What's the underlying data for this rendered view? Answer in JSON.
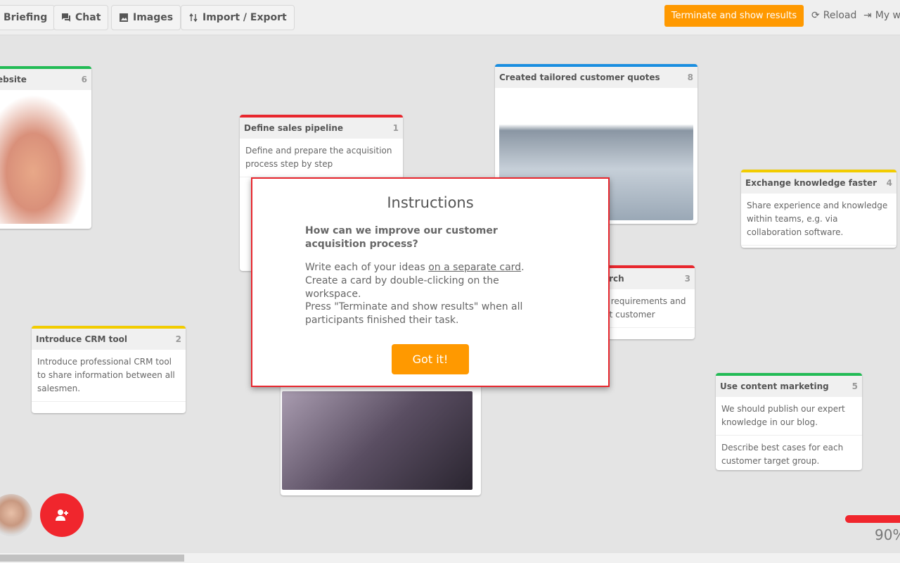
{
  "toolbar": {
    "briefing": "Briefing",
    "chat": "Chat",
    "images": "Images",
    "import_export": "Import / Export",
    "terminate": "Terminate and show results",
    "reload": "Reload",
    "my": "My w"
  },
  "cards": [
    {
      "title": "ebsite",
      "count": "6",
      "color": "#22bb55"
    },
    {
      "title": "Define sales pipeline",
      "count": "1",
      "color": "#e8262d",
      "text": "Define and prepare the acquisition process step by step"
    },
    {
      "title": "Created tailored customer quotes",
      "count": "8",
      "color": "#1a8ee0"
    },
    {
      "title": "Exchange knowledge faster",
      "count": "4",
      "color": "#f2cc00",
      "text": "Share experience and knowledge within teams, e.g. via collaboration software."
    },
    {
      "title": "arch",
      "count": "3",
      "color": "#e8262d",
      "line1": "r requirements and",
      "line2": "ct customer"
    },
    {
      "title": "Introduce CRM tool",
      "count": "2",
      "color": "#f2cc00",
      "text": "Introduce professional CRM tool to share information between all salesmen."
    },
    {
      "title": "Use content marketing",
      "count": "5",
      "color": "#22bb55",
      "text": "We should publish our expert knowledge in our blog.",
      "text2": "Describe best cases for each customer target group."
    }
  ],
  "modal": {
    "title": "Instructions",
    "question": "How can we improve our customer acquisition process?",
    "p1_a": "Write each of your ideas ",
    "p1_link": "on a separate card",
    "p1_b": ". Create a card by double-clicking on the workspace.",
    "p2": "Press \"Terminate and show results\" when all participants finished their task.",
    "button": "Got it!"
  },
  "progress": {
    "value": 90,
    "label": "90%"
  },
  "colors": {
    "accent": "#ff9900",
    "red": "#e8262d"
  }
}
